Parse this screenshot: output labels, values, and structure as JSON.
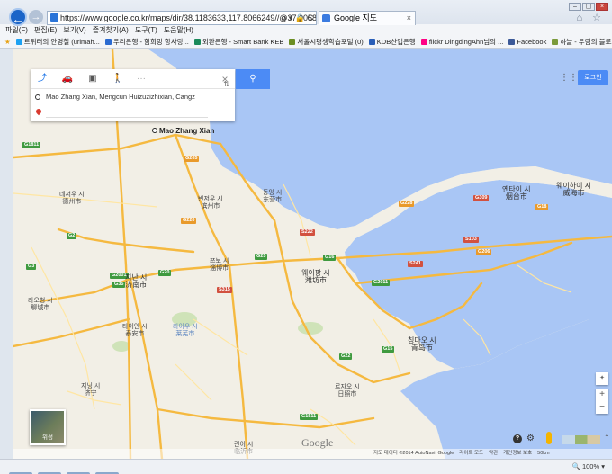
{
  "browser": {
    "url": "https://www.google.co.kr/maps/dir/38.1183633,117.8066249//@37.0058542,119.19",
    "address_controls": "ρ ▾ 🔒 C",
    "tab_title": "Google 지도",
    "tab_close": "×",
    "back_icon": "back-arrow-icon",
    "forward_icon": "forward-arrow-icon",
    "chrome_icons": "⌂ ☆"
  },
  "menu": [
    "파일(F)",
    "편집(E)",
    "보기(V)",
    "즐겨찾기(A)",
    "도구(T)",
    "도움말(H)"
  ],
  "favorites": [
    {
      "label": "트위터의 안명철 (urimah...",
      "color": "#1da1f2"
    },
    {
      "label": "우리은행 - 함희망 항사랑...",
      "color": "#2a6ad1"
    },
    {
      "label": "외환은행 - Smart Bank KEB",
      "color": "#1b8a5a"
    },
    {
      "label": "서울시평생학습포털 (0)",
      "color": "#6b8e23"
    },
    {
      "label": "KDB산업은행",
      "color": "#2a5fb8"
    },
    {
      "label": "flickr DingdingAhn님의 ...",
      "color": "#ff0084"
    },
    {
      "label": "Facebook",
      "color": "#3b5998"
    },
    {
      "label": "하늘 - 우림의 블로그 - 산...",
      "color": "#7a9a3a"
    }
  ],
  "directions": {
    "modes": [
      "drive-icon",
      "car-icon",
      "transit-icon",
      "walk-icon"
    ],
    "more": "···",
    "close": "×",
    "search_icon": "search-icon",
    "search_symbol": "⚲",
    "origin": "Mao Zhang Xian, Mengcun Huizuzizhixian, Cangz",
    "destination": "",
    "swap": "⇅"
  },
  "map": {
    "origin_label": "Mao Zhang Xian",
    "login_label": "로그인",
    "apps_icon": "apps-grid-icon",
    "apps_symbol": "⋮⋮⋮",
    "satellite_label": "위성",
    "google_logo": "Google",
    "compass_symbol": "✦",
    "zoom_in": "+",
    "zoom_out": "−",
    "help_symbol": "?",
    "settings_symbol": "⚙",
    "expand_symbol": "⌃",
    "cities": [
      {
        "name": "웨이하이 시\n威海市",
        "big": true
      },
      {
        "name": "옌타이 시\n烟台市",
        "big": true
      },
      {
        "name": "동잉 시\n东营市",
        "big": false
      },
      {
        "name": "빈저우 시\n滨州市",
        "big": false
      },
      {
        "name": "데저우 시\n德州市",
        "big": false
      },
      {
        "name": "쯔보 시\n淄博市",
        "big": false
      },
      {
        "name": "웨이팡 시\n潍坊市",
        "big": true
      },
      {
        "name": "지난 시\n济南市",
        "big": true
      },
      {
        "name": "라오청 시\n聊城市",
        "big": false
      },
      {
        "name": "타이안 시\n泰安市",
        "big": false
      },
      {
        "name": "라이우 시\n莱芜市",
        "big": false
      },
      {
        "name": "칭다오 시\n青岛市",
        "big": true
      },
      {
        "name": "르자오 시\n日照市",
        "big": false
      },
      {
        "name": "지닝 시\n济宁",
        "big": false
      },
      {
        "name": "린이 시\n临沂市",
        "big": false
      }
    ],
    "shields": [
      "G1811",
      "G3",
      "G18",
      "G205",
      "S222",
      "G2",
      "G20",
      "G2001",
      "G35",
      "G220",
      "G25",
      "S315",
      "G22",
      "S103",
      "G15",
      "G2011",
      "G16",
      "G1511",
      "G228",
      "G309",
      "G206",
      "S241"
    ],
    "attribution": [
      "지도 데이터 ©2014 AutoNavi, Google",
      "라이트 모드",
      "약관",
      "개인정보 보호",
      "50km"
    ]
  },
  "status": {
    "zoom": "🔍 100% ▾"
  },
  "colors": {
    "water": "#a9c6f5",
    "land": "#f2efe6",
    "highway": "#f5b940",
    "road": "#ffe6a3",
    "accent": "#4c8bf5"
  }
}
